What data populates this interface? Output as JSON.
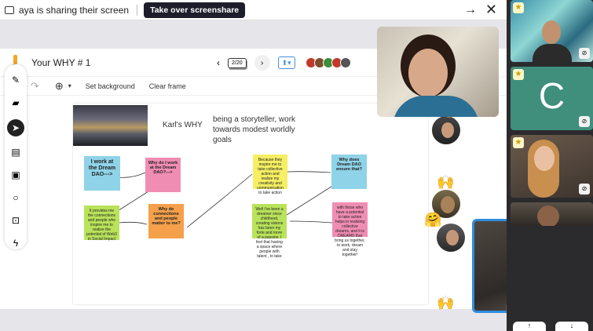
{
  "share_bar": {
    "message": "aya is sharing their screen",
    "take_over_label": "Take over screenshare",
    "arrow_glyph": "→",
    "close_glyph": "✕"
  },
  "board": {
    "title": "Your WHY # 1",
    "page_indicator": "2/20",
    "toolbar": {
      "set_background": "Set background",
      "clear_frame": "Clear frame"
    }
  },
  "canvas": {
    "heading_left": "Karl's WHY",
    "heading_right": "being a storyteller, work towards modest worldly goals",
    "notes": {
      "n1": "I work at the Dream DAO--->",
      "n2": "Why do I work at the Dream DAO?--->",
      "n3": "It provides me the connections and people who inspire me to realize the potential of Web3 in Social Impact",
      "n4": "Why do connections and people matter to me?",
      "n5": "Because they inspire me to take collective action and realize my creativity and communication to take action",
      "n6": "Why does Dream DAO ensure that?",
      "n7": "Well I've been a dreamer since childhood, creating visions has been my forte and more of a passion. I feel that having a space where people with talent , to take",
      "n8": "with those who have a potential to take action helps in realizing collective dreams, and it is DREAMS that bring us together, to work, dream and stay together!"
    },
    "colors": {
      "blue": "#8fd3e8",
      "pink": "#f08db3",
      "green": "#b9e35a",
      "orange": "#f5a04a",
      "yellow": "#f6ef63"
    }
  },
  "participants": {
    "tile2_initial": "C"
  }
}
